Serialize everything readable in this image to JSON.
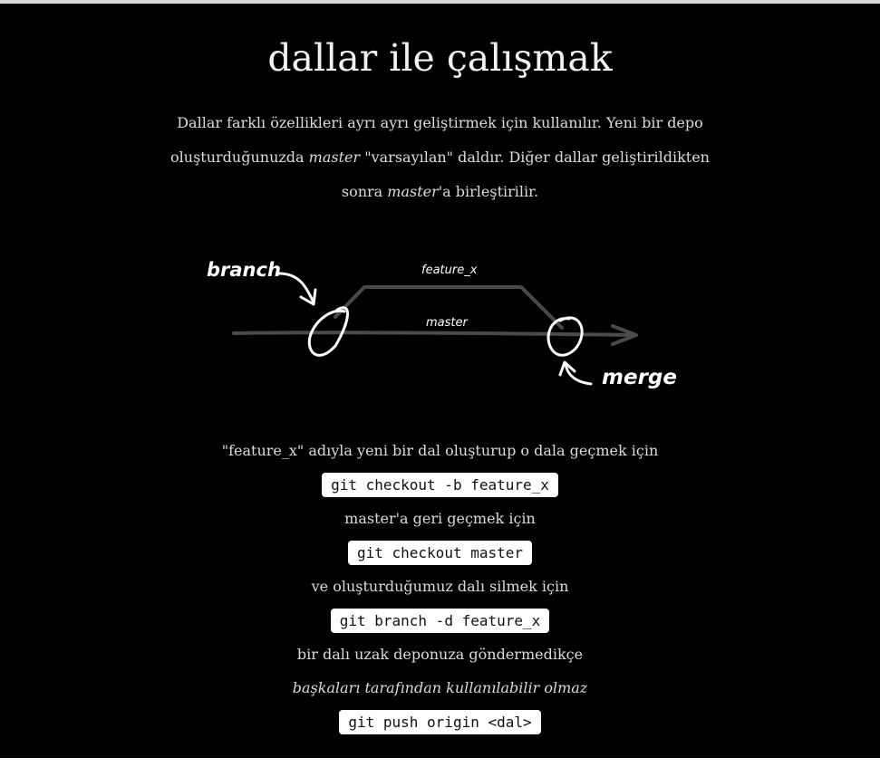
{
  "page": {
    "title": "dallar ile çalışmak",
    "intro": {
      "part1": "Dallar farklı özellikleri ayrı ayrı geliştirmek için kullanılır. Yeni bir depo oluşturduğunuzda ",
      "em1": "master",
      "part2": " \"varsayılan\" daldır. Diğer dallar geliştirildikten sonra ",
      "em2": "master",
      "part3": "'a birleştirilir."
    }
  },
  "diagram": {
    "label_branch": "branch",
    "label_feature": "feature_x",
    "label_master": "master",
    "label_merge": "merge"
  },
  "steps": [
    {
      "text": "\"feature_x\" adıyla yeni bir dal oluşturup o dala geçmek için",
      "code": "git checkout -b feature_x"
    },
    {
      "text": "master'a geri geçmek için",
      "code": "git checkout master"
    },
    {
      "text": "ve oluşturduğumuz dalı silmek için",
      "code": "git branch -d feature_x"
    },
    {
      "text": "bir dalı uzak deponuza göndermedikçe",
      "text_italic": "başkaları tarafından kullanılabilir olmaz",
      "code": "git push origin <dal>"
    }
  ]
}
